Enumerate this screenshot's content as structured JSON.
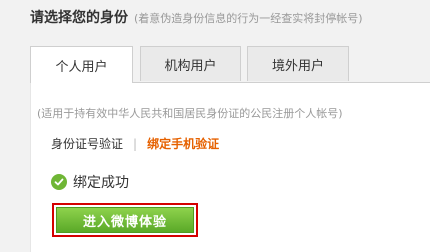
{
  "header": {
    "title": "请选择您的身份",
    "note": "(着意伪造身份信息的行为一经查实将封停帐号)"
  },
  "tabs": [
    {
      "label": "个人用户",
      "active": true
    },
    {
      "label": "机构用户",
      "active": false
    },
    {
      "label": "境外用户",
      "active": false
    }
  ],
  "panel": {
    "note": "(适用于持有效中华人民共和国居民身份证的公民注册个人帐号)",
    "verify_id": "身份证号验证",
    "divider": "|",
    "verify_phone": "绑定手机验证",
    "success_text": "绑定成功",
    "enter_button": "进入微博体验"
  },
  "colors": {
    "accent_orange": "#e66100",
    "success_green": "#6fb635",
    "button_green": "#5aa928",
    "highlight_red": "#d40000"
  },
  "icons": {
    "success": "check-circle-icon"
  }
}
